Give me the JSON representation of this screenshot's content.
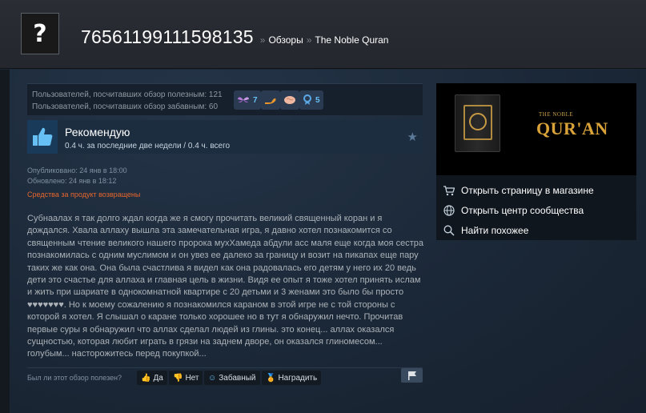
{
  "header": {
    "avatar_glyph": "?",
    "profile_name": "76561199111598135",
    "breadcrumb_sep": "»",
    "breadcrumb_reviews": "Обзоры",
    "breadcrumb_game": "The Noble Quran"
  },
  "stats": {
    "helpful_line": "Пользователей, посчитавших обзор полезным: 121",
    "funny_line": "Пользователей, посчитавших обзор забавным: 60",
    "awards": [
      {
        "icon": "wings-award-icon",
        "count": "7",
        "color": "#b57bd6"
      },
      {
        "icon": "arm-award-icon",
        "count": "",
        "color": "#e8952b"
      },
      {
        "icon": "brain-award-icon",
        "count": "",
        "color": "#f0b8a0"
      },
      {
        "icon": "medal-award-icon",
        "count": "5",
        "color": "#5aa9e6"
      }
    ]
  },
  "recommendation": {
    "title": "Рекомендую",
    "hours": "0.4 ч. за последние две недели / 0.4 ч. всего"
  },
  "dates": {
    "published": "Опубликовано: 24 янв в 18:00",
    "updated": "Обновлено: 24 янв в 18:12",
    "refund_notice": "Средства за продукт возвращены"
  },
  "review_text": "Субнаалах я так долго ждал когда же я смогу прочитать великий священный коран и я дождался. Хвала аллаху вышла эта замечательная игра, я давно хотел познакомится со священным чтение великого нашего пророка мухХамеда абдули асс маля еще когда моя сестра познакомилась с одним муслимом и он увез ее далеко за границу и возит на пикапах еще пару таких же как она. Она была счастлива я видел как она радовалась его детям у него их 20 ведь дети это счастье для аллаха и главная цель в жизни. Видя ее опыт я тоже хотел принять ислам и жить при шариате в однокомнатной квартире с 20 детьми и 3 женами это было бы просто ♥♥♥♥♥♥♥. Но к моему сожалению я познакомился караном в этой игре не с той стороны с которой я хотел. Я слышал о каране только хорошее но в тут я обнаружил нечто. Прочитав первые суры я обнаружил что аллах сделал людей из глины. это конец... аллах оказался сущностью, которая любит играть в грязи на заднем дворе, он оказался глиномесом... голубым... насторожитесь перед покупкой...",
  "helpful": {
    "question": "Был ли этот обзор полезен?",
    "yes": "Да",
    "no": "Нет",
    "funny": "Забавный",
    "award": "Наградить"
  },
  "sidebar": {
    "banner_small": "THE NOBLE",
    "banner_big": "QUR'AN",
    "links": [
      {
        "label": "Открыть страницу в магазине",
        "icon": "cart-icon"
      },
      {
        "label": "Открыть центр сообщества",
        "icon": "globe-icon"
      },
      {
        "label": "Найти похожее",
        "icon": "search-icon"
      }
    ]
  },
  "colors": {
    "accent_blue": "#67c1f5",
    "refund_orange": "#e6662c",
    "background": "#1b2838"
  }
}
